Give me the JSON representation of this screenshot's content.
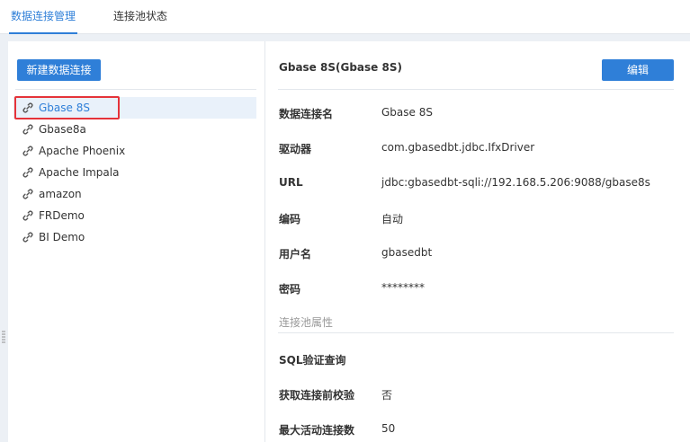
{
  "tabs": [
    {
      "label": "数据连接管理"
    },
    {
      "label": "连接池状态"
    }
  ],
  "left": {
    "new_button": "新建数据连接",
    "connections": [
      {
        "name": "Gbase 8S",
        "selected": true
      },
      {
        "name": "Gbase8a"
      },
      {
        "name": "Apache Phoenix"
      },
      {
        "name": "Apache Impala"
      },
      {
        "name": "amazon"
      },
      {
        "name": "FRDemo"
      },
      {
        "name": "BI Demo"
      }
    ]
  },
  "detail": {
    "title": "Gbase 8S(Gbase 8S)",
    "edit_button": "编辑",
    "rows": [
      {
        "label": "数据连接名",
        "value": "Gbase 8S"
      },
      {
        "label": "驱动器",
        "value": "com.gbasedbt.jdbc.IfxDriver"
      },
      {
        "label": "URL",
        "value": "jdbc:gbasedbt-sqli://192.168.5.206:9088/gbase8s"
      },
      {
        "label": "编码",
        "value": "自动"
      },
      {
        "label": "用户名",
        "value": "gbasedbt"
      },
      {
        "label": "密码",
        "value": "********"
      }
    ],
    "pool_section": "连接池属性",
    "pool_rows": [
      {
        "label": "SQL验证查询",
        "value": ""
      },
      {
        "label": "获取连接前校验",
        "value": "否"
      },
      {
        "label": "最大活动连接数",
        "value": "50"
      }
    ]
  },
  "colors": {
    "accent": "#2f7fd8",
    "highlight": "#e5333a",
    "background": "#ecf0f5"
  }
}
